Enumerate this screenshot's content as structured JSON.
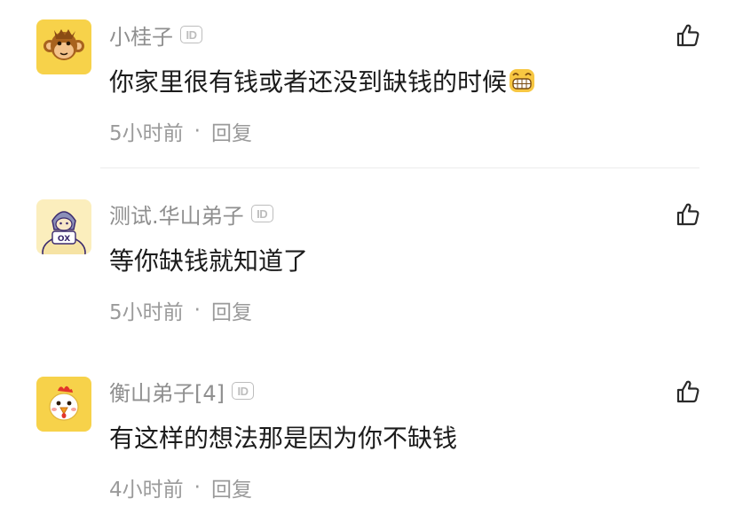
{
  "comments": [
    {
      "username": "小桂子",
      "badge": "ID",
      "text": "你家里很有钱或者还没到缺钱的时候",
      "time": "5小时前",
      "separator": "·",
      "reply": "回复",
      "avatar_icon": "monkey-icon",
      "emoji_icon": "grinning-face-emoji-icon"
    },
    {
      "username": "测试.华山弟子",
      "badge": "ID",
      "text": "等你缺钱就知道了",
      "time": "5小时前",
      "separator": "·",
      "reply": "回复",
      "avatar_icon": "ox-character-icon"
    },
    {
      "username": "衡山弟子[4]",
      "badge": "ID",
      "text": "有这样的想法那是因为你不缺钱",
      "time": "4小时前",
      "separator": "·",
      "reply": "回复",
      "avatar_icon": "chicken-icon"
    }
  ],
  "colors": {
    "username": "#8f8f8f",
    "text": "#1c1c1c",
    "meta": "#9a9a9a",
    "avatar_bg": "#f7d24a",
    "divider": "#ececec"
  }
}
